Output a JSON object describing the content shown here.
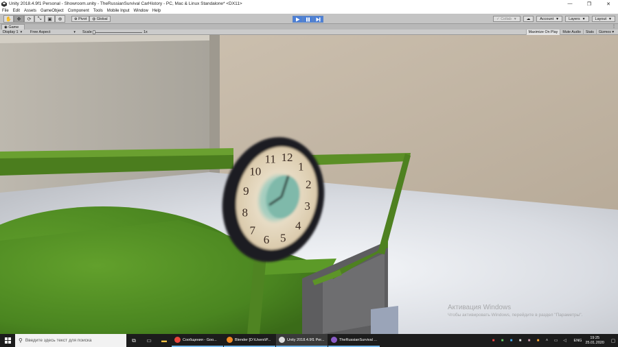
{
  "window": {
    "title": "Unity 2018.4.9f1 Personal - Showroom.unity - TheRussianSurvival CarHistory - PC, Mac & Linux Standalone* <DX11>",
    "minimize_glyph": "—",
    "maximize_glyph": "❐",
    "close_glyph": "✕"
  },
  "menu": [
    "File",
    "Edit",
    "Assets",
    "GameObject",
    "Component",
    "Tools",
    "Mobile Input",
    "Window",
    "Help"
  ],
  "toolbar": {
    "tools": [
      {
        "icon": "hand-icon",
        "glyph": "✋"
      },
      {
        "icon": "move-icon",
        "glyph": "✥"
      },
      {
        "icon": "rotate-icon",
        "glyph": "⟳"
      },
      {
        "icon": "scale-icon",
        "glyph": "⤡"
      },
      {
        "icon": "rect-tool-icon",
        "glyph": "▣"
      },
      {
        "icon": "transform-tool-icon",
        "glyph": "⊕"
      }
    ],
    "pivot_label": "Pivot",
    "global_label": "Global",
    "collab_label": "Collab",
    "account_label": "Account",
    "layers_label": "Layers",
    "layout_label": "Layout"
  },
  "game_view": {
    "tab_label": "Game",
    "display_label": "Display 1",
    "aspect_label": "Free Aspect",
    "scale_label": "Scale",
    "scale_value": "1x",
    "maximize_label": "Maximize On Play",
    "mute_label": "Mute Audio",
    "stats_label": "Stats",
    "gizmos_label": "Gizmos",
    "clock_numerals": [
      "12",
      "1",
      "2",
      "3",
      "4",
      "5",
      "6",
      "7",
      "8",
      "9",
      "10",
      "11"
    ]
  },
  "watermark": {
    "title": "Активация Windows",
    "subtitle": "Чтобы активировать Windows, перейдите в раздел \"Параметры\"."
  },
  "taskbar": {
    "search_placeholder": "Введите здесь текст для поиска",
    "apps": [
      {
        "label": "Сообщения - Goo...",
        "color": "#e8453c"
      },
      {
        "label": "Blender [D:\\Users\\P...",
        "color": "#f08a24"
      },
      {
        "label": "Unity 2018.4.9f1 Per...",
        "color": "#dddddd"
      },
      {
        "label": "TheRussianSurvival ...",
        "color": "#8a5cc7"
      }
    ],
    "language": "ENG",
    "time": "19:25",
    "date": "25.01.2020"
  },
  "colors": {
    "accent": "#4c7fd6",
    "taskbar": "#1c1c1c",
    "grass_green": "#4f8a22"
  }
}
